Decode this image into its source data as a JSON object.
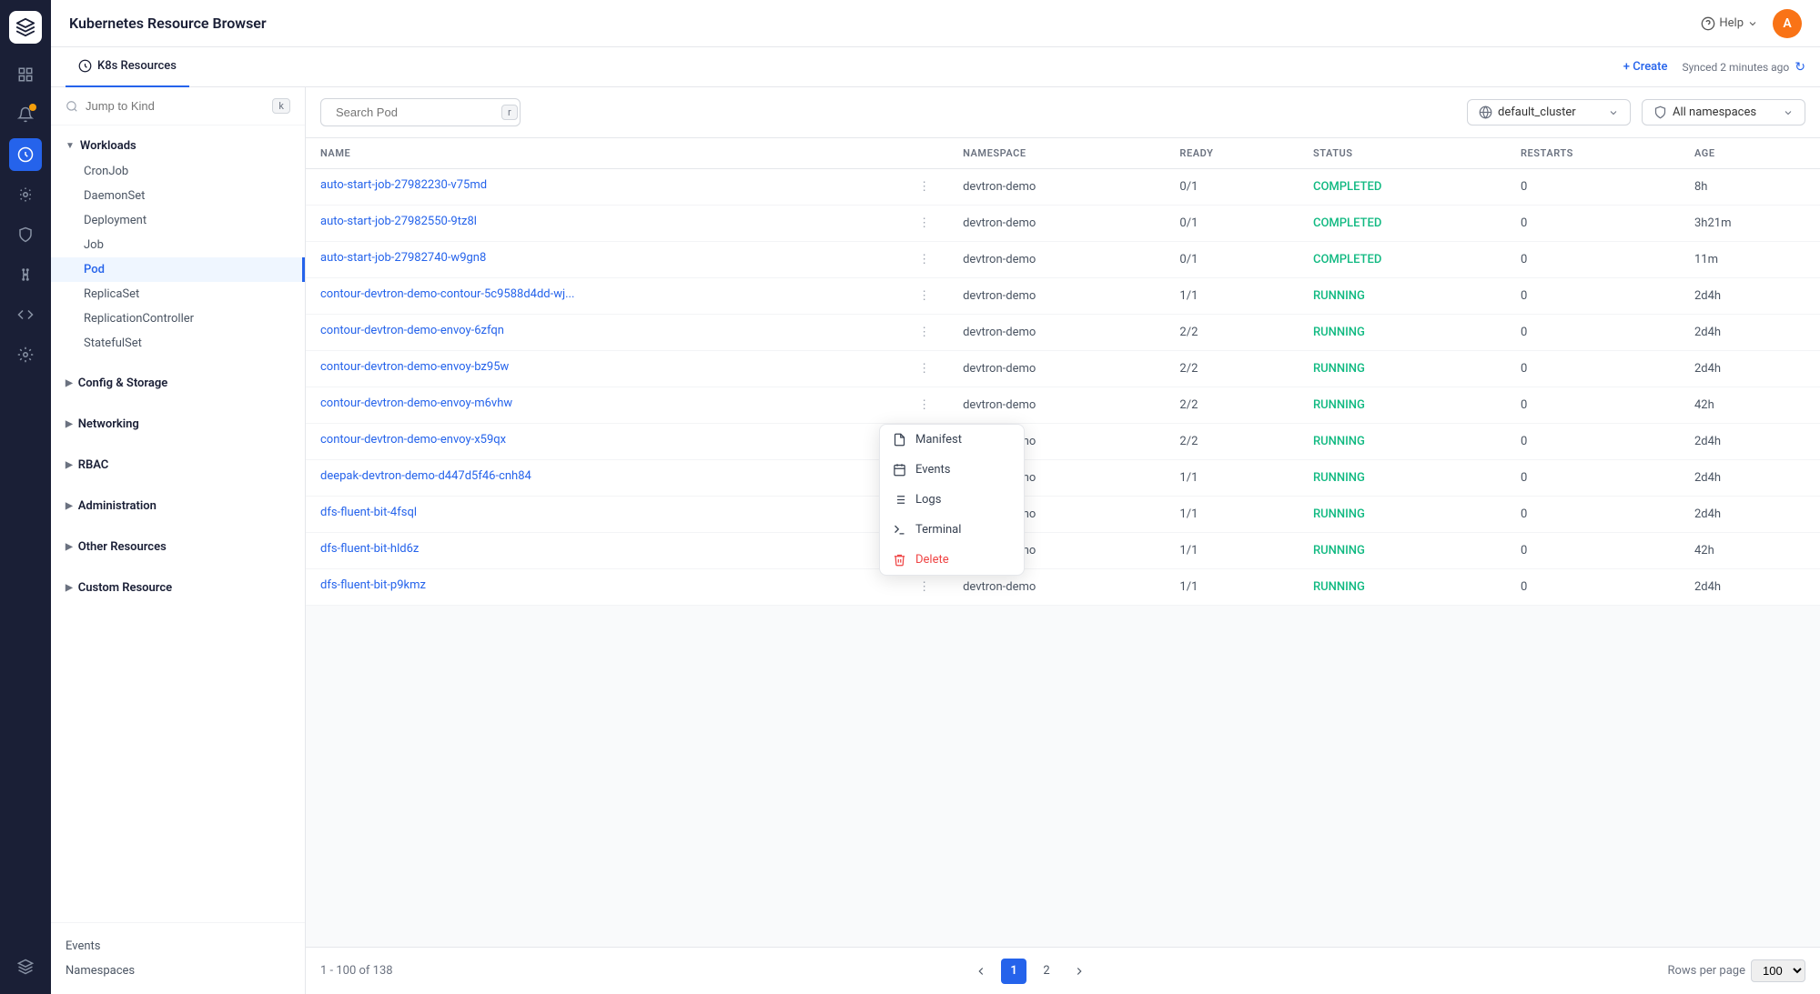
{
  "app": {
    "title": "Kubernetes Resource Browser",
    "help_label": "Help",
    "user_initial": "A"
  },
  "tabs": [
    {
      "id": "k8s",
      "label": "K8s Resources",
      "active": true
    }
  ],
  "toolbar": {
    "create_label": "+ Create",
    "sync_label": "Synced 2 minutes ago",
    "search_placeholder": "Search Pod",
    "search_shortcut": "r",
    "cluster_value": "default_cluster",
    "namespace_value": "All namespaces"
  },
  "left_nav": {
    "search_placeholder": "Jump to Kind",
    "search_shortcut": "k",
    "sections": [
      {
        "id": "workloads",
        "label": "Workloads",
        "expanded": true,
        "items": [
          {
            "id": "cronjob",
            "label": "CronJob",
            "active": false
          },
          {
            "id": "daemonset",
            "label": "DaemonSet",
            "active": false
          },
          {
            "id": "deployment",
            "label": "Deployment",
            "active": false
          },
          {
            "id": "job",
            "label": "Job",
            "active": false
          },
          {
            "id": "pod",
            "label": "Pod",
            "active": true
          },
          {
            "id": "replicaset",
            "label": "ReplicaSet",
            "active": false
          },
          {
            "id": "replicationcontroller",
            "label": "ReplicationController",
            "active": false
          },
          {
            "id": "statefulset",
            "label": "StatefulSet",
            "active": false
          }
        ]
      },
      {
        "id": "config-storage",
        "label": "Config & Storage",
        "expanded": false,
        "items": []
      },
      {
        "id": "networking",
        "label": "Networking",
        "expanded": false,
        "items": []
      },
      {
        "id": "rbac",
        "label": "RBAC",
        "expanded": false,
        "items": []
      },
      {
        "id": "administration",
        "label": "Administration",
        "expanded": false,
        "items": []
      },
      {
        "id": "other-resources",
        "label": "Other Resources",
        "expanded": false,
        "items": []
      },
      {
        "id": "custom-resource",
        "label": "Custom Resource",
        "expanded": false,
        "items": []
      }
    ],
    "bottom_items": [
      {
        "id": "events",
        "label": "Events"
      },
      {
        "id": "namespaces",
        "label": "Namespaces"
      }
    ]
  },
  "table": {
    "columns": [
      "NAME",
      "NAMESPACE",
      "READY",
      "STATUS",
      "RESTARTS",
      "AGE"
    ],
    "rows": [
      {
        "name": "auto-start-job-27982230-v75md",
        "namespace": "devtron-demo",
        "ready": "0/1",
        "status": "COMPLETED",
        "restarts": "0",
        "age": "8h"
      },
      {
        "name": "auto-start-job-27982550-9tz8l",
        "namespace": "devtron-demo",
        "ready": "0/1",
        "status": "COMPLETED",
        "restarts": "0",
        "age": "3h21m"
      },
      {
        "name": "auto-start-job-27982740-w9gn8",
        "namespace": "devtron-demo",
        "ready": "0/1",
        "status": "COMPLETED",
        "restarts": "0",
        "age": "11m"
      },
      {
        "name": "contour-devtron-demo-contour-5c9588d4dd-wj...",
        "namespace": "devtron-demo",
        "ready": "1/1",
        "status": "RUNNING",
        "restarts": "0",
        "age": "2d4h",
        "menu_open": true
      },
      {
        "name": "contour-devtron-demo-envoy-6zfqn",
        "namespace": "devtron-demo",
        "ready": "2/2",
        "status": "RUNNING",
        "restarts": "0",
        "age": "2d4h"
      },
      {
        "name": "contour-devtron-demo-envoy-bz95w",
        "namespace": "devtron-demo",
        "ready": "2/2",
        "status": "RUNNING",
        "restarts": "0",
        "age": "2d4h"
      },
      {
        "name": "contour-devtron-demo-envoy-m6vhw",
        "namespace": "devtron-demo",
        "ready": "2/2",
        "status": "RUNNING",
        "restarts": "0",
        "age": "42h"
      },
      {
        "name": "contour-devtron-demo-envoy-x59qx",
        "namespace": "devtron-demo",
        "ready": "2/2",
        "status": "RUNNING",
        "restarts": "0",
        "age": "2d4h"
      },
      {
        "name": "deepak-devtron-demo-d447d5f46-cnh84",
        "namespace": "devtron-demo",
        "ready": "1/1",
        "status": "RUNNING",
        "restarts": "0",
        "age": "2d4h"
      },
      {
        "name": "dfs-fluent-bit-4fsql",
        "namespace": "devtron-demo",
        "ready": "1/1",
        "status": "RUNNING",
        "restarts": "0",
        "age": "2d4h"
      },
      {
        "name": "dfs-fluent-bit-hld6z",
        "namespace": "devtron-demo",
        "ready": "1/1",
        "status": "RUNNING",
        "restarts": "0",
        "age": "42h"
      },
      {
        "name": "dfs-fluent-bit-p9kmz",
        "namespace": "devtron-demo",
        "ready": "1/1",
        "status": "RUNNING",
        "restarts": "0",
        "age": "2d4h"
      }
    ]
  },
  "context_menu": {
    "items": [
      {
        "id": "manifest",
        "label": "Manifest",
        "icon": "file-icon"
      },
      {
        "id": "events",
        "label": "Events",
        "icon": "calendar-icon"
      },
      {
        "id": "logs",
        "label": "Logs",
        "icon": "logs-icon"
      },
      {
        "id": "terminal",
        "label": "Terminal",
        "icon": "terminal-icon"
      },
      {
        "id": "delete",
        "label": "Delete",
        "icon": "trash-icon",
        "danger": true
      }
    ]
  },
  "pagination": {
    "info": "1 - 100 of 138",
    "current_page": 1,
    "total_pages": 2,
    "rows_per_page_label": "Rows per page",
    "rows_per_page_value": "100"
  }
}
